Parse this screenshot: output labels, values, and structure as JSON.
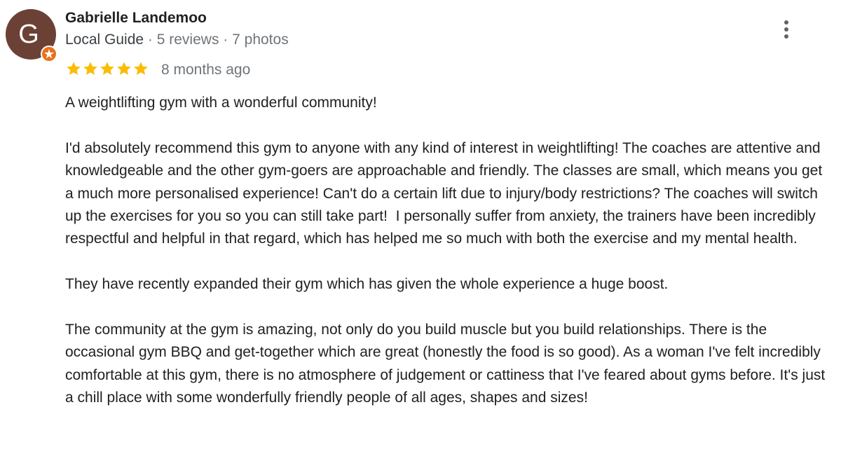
{
  "review": {
    "avatar_letter": "G",
    "reviewer_name": "Gabrielle Landemoo",
    "guide_label": "Local Guide",
    "separator": " · ",
    "reviews_count": "5 reviews",
    "photos_count": "7 photos",
    "rating": 5,
    "rating_max": 5,
    "date": "8 months ago",
    "paragraphs": [
      "A weightlifting gym with a wonderful community!",
      "I'd absolutely recommend this gym to anyone with any kind of interest in weightlifting! The coaches are attentive and knowledgeable and the other gym-goers are approachable and friendly. The classes are small, which means you get a much more personalised experience! Can't do a certain lift due to injury/body restrictions? The coaches will switch up the exercises for you so you can still take part!  I personally suffer from anxiety, the trainers have been incredibly respectful and helpful in that regard, which has helped me so much with both the exercise and my mental health.",
      "They have recently expanded their gym which has given the whole experience a huge boost.",
      "The community at the gym is amazing, not only do you build muscle but you build relationships. There is the occasional gym BBQ and get-together which are great (honestly the food is so good). As a woman I've felt incredibly comfortable at this gym, there is no atmosphere of judgement or cattiness that I've feared about gyms before. It's just a chill place with some wonderfully friendly people of all ages, shapes and sizes!"
    ]
  },
  "icons": {
    "star": "star-icon",
    "badge": "local-guide-badge-icon",
    "menu": "more-vert-icon"
  },
  "colors": {
    "avatar_bg": "#6b4136",
    "badge": "#e8711a",
    "star": "#fbbc04",
    "secondary_text": "#70757a",
    "primary_text": "#202124"
  }
}
